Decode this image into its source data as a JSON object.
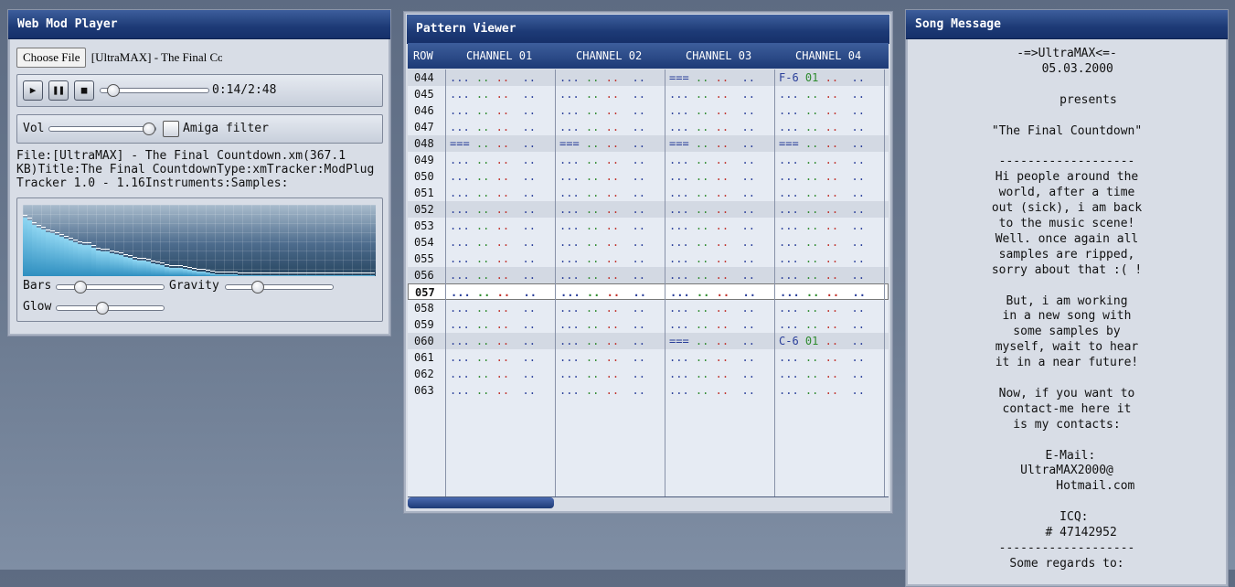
{
  "player": {
    "title": "Web Mod Player",
    "choose_file_label": "Choose File",
    "chosen_file": "[UltraMAX] - The Final Countdown.xm",
    "time_display": "0:14/2:48",
    "play_progress": 0.083,
    "vol_label": "Vol",
    "volume": 0.98,
    "amiga_filter_label": "Amiga filter",
    "amiga_filter_checked": false,
    "info_text": "File:[UltraMAX] - The Final Countdown.xm(367.1 KB)Title:The Final CountdownType:xmTracker:ModPlug Tracker 1.0 - 1.16Instruments:Samples:",
    "bars_label": "Bars",
    "bars_value": 0.2,
    "gravity_label": "Gravity",
    "gravity_value": 0.28,
    "glow_label": "Glow",
    "glow_value": 0.42,
    "spectrum_levels": [
      0.82,
      0.78,
      0.72,
      0.68,
      0.66,
      0.62,
      0.6,
      0.58,
      0.55,
      0.53,
      0.5,
      0.47,
      0.45,
      0.44,
      0.43,
      0.4,
      0.36,
      0.35,
      0.34,
      0.32,
      0.31,
      0.29,
      0.27,
      0.25,
      0.23,
      0.22,
      0.22,
      0.2,
      0.18,
      0.17,
      0.15,
      0.13,
      0.12,
      0.12,
      0.11,
      0.1,
      0.09,
      0.08,
      0.07,
      0.06,
      0.05,
      0.04,
      0.03,
      0.03,
      0.02,
      0.02,
      0.02,
      0.01,
      0.01,
      0.01,
      0.01,
      0.01,
      0.01,
      0.01,
      0.01,
      0.01,
      0.01,
      0.01,
      0.01,
      0.01,
      0.01,
      0.01,
      0.01,
      0.01,
      0.01,
      0.01,
      0.01,
      0.01,
      0.01,
      0.01,
      0.01,
      0.01,
      0.01,
      0.01,
      0.01,
      0.01,
      0.01
    ]
  },
  "pattern": {
    "title": "Pattern Viewer",
    "columns": [
      "ROW",
      "CHANNEL 01",
      "CHANNEL 02",
      "CHANNEL 03",
      "CHANNEL 04"
    ],
    "rows": [
      {
        "row": "044",
        "cells": [
          "... .. ..  ..",
          "... .. ..  ..",
          "=== .. ..  ..",
          "F-6 01 ..  .."
        ]
      },
      {
        "row": "045",
        "cells": [
          "... .. ..  ..",
          "... .. ..  ..",
          "... .. ..  ..",
          "... .. ..  .."
        ]
      },
      {
        "row": "046",
        "cells": [
          "... .. ..  ..",
          "... .. ..  ..",
          "... .. ..  ..",
          "... .. ..  .."
        ]
      },
      {
        "row": "047",
        "cells": [
          "... .. ..  ..",
          "... .. ..  ..",
          "... .. ..  ..",
          "... .. ..  .."
        ]
      },
      {
        "row": "048",
        "cells": [
          "=== .. ..  ..",
          "=== .. ..  ..",
          "=== .. ..  ..",
          "=== .. ..  .."
        ]
      },
      {
        "row": "049",
        "cells": [
          "... .. ..  ..",
          "... .. ..  ..",
          "... .. ..  ..",
          "... .. ..  .."
        ]
      },
      {
        "row": "050",
        "cells": [
          "... .. ..  ..",
          "... .. ..  ..",
          "... .. ..  ..",
          "... .. ..  .."
        ]
      },
      {
        "row": "051",
        "cells": [
          "... .. ..  ..",
          "... .. ..  ..",
          "... .. ..  ..",
          "... .. ..  .."
        ]
      },
      {
        "row": "052",
        "cells": [
          "... .. ..  ..",
          "... .. ..  ..",
          "... .. ..  ..",
          "... .. ..  .."
        ]
      },
      {
        "row": "053",
        "cells": [
          "... .. ..  ..",
          "... .. ..  ..",
          "... .. ..  ..",
          "... .. ..  .."
        ]
      },
      {
        "row": "054",
        "cells": [
          "... .. ..  ..",
          "... .. ..  ..",
          "... .. ..  ..",
          "... .. ..  .."
        ]
      },
      {
        "row": "055",
        "cells": [
          "... .. ..  ..",
          "... .. ..  ..",
          "... .. ..  ..",
          "... .. ..  .."
        ]
      },
      {
        "row": "056",
        "cells": [
          "... .. ..  ..",
          "... .. ..  ..",
          "... .. ..  ..",
          "... .. ..  .."
        ]
      },
      {
        "row": "057",
        "cells": [
          "... .. ..  ..",
          "... .. ..  ..",
          "... .. ..  ..",
          "... .. ..  .."
        ]
      },
      {
        "row": "058",
        "cells": [
          "... .. ..  ..",
          "... .. ..  ..",
          "... .. ..  ..",
          "... .. ..  .."
        ]
      },
      {
        "row": "059",
        "cells": [
          "... .. ..  ..",
          "... .. ..  ..",
          "... .. ..  ..",
          "... .. ..  .."
        ]
      },
      {
        "row": "060",
        "cells": [
          "... .. ..  ..",
          "... .. ..  ..",
          "=== .. ..  ..",
          "C-6 01 ..  .."
        ]
      },
      {
        "row": "061",
        "cells": [
          "... .. ..  ..",
          "... .. ..  ..",
          "... .. ..  ..",
          "... .. ..  .."
        ]
      },
      {
        "row": "062",
        "cells": [
          "... .. ..  ..",
          "... .. ..  ..",
          "... .. ..  ..",
          "... .. ..  .."
        ]
      },
      {
        "row": "063",
        "cells": [
          "... .. ..  ..",
          "... .. ..  ..",
          "... .. ..  ..",
          "... .. ..  .."
        ]
      }
    ],
    "current_row": "057",
    "colors": {
      "note": "#2a3f9a",
      "instrument": "#2e8b2e",
      "volume": "#c0302a",
      "effect": "#2a3f9a"
    }
  },
  "song": {
    "title": "Song Message",
    "message": "-=>UltraMAX<=-\n   05.03.2000\n\n      presents\n\n\"The Final Countdown\"\n\n-------------------\nHi people around the\nworld, after a time\nout (sick), i am back\nto the music scene!\nWell. once again all\nsamples are ripped,\nsorry about that :( !\n\nBut, i am working\nin a new song with\nsome samples by\nmyself, wait to hear\nit in a near future!\n\nNow, if you want to\ncontact-me here it\nis my contacts:\n\n E-Mail:\nUltraMAX2000@\n        Hotmail.com\n\n  ICQ:\n    # 47142952\n-------------------\nSome regards to:"
  }
}
